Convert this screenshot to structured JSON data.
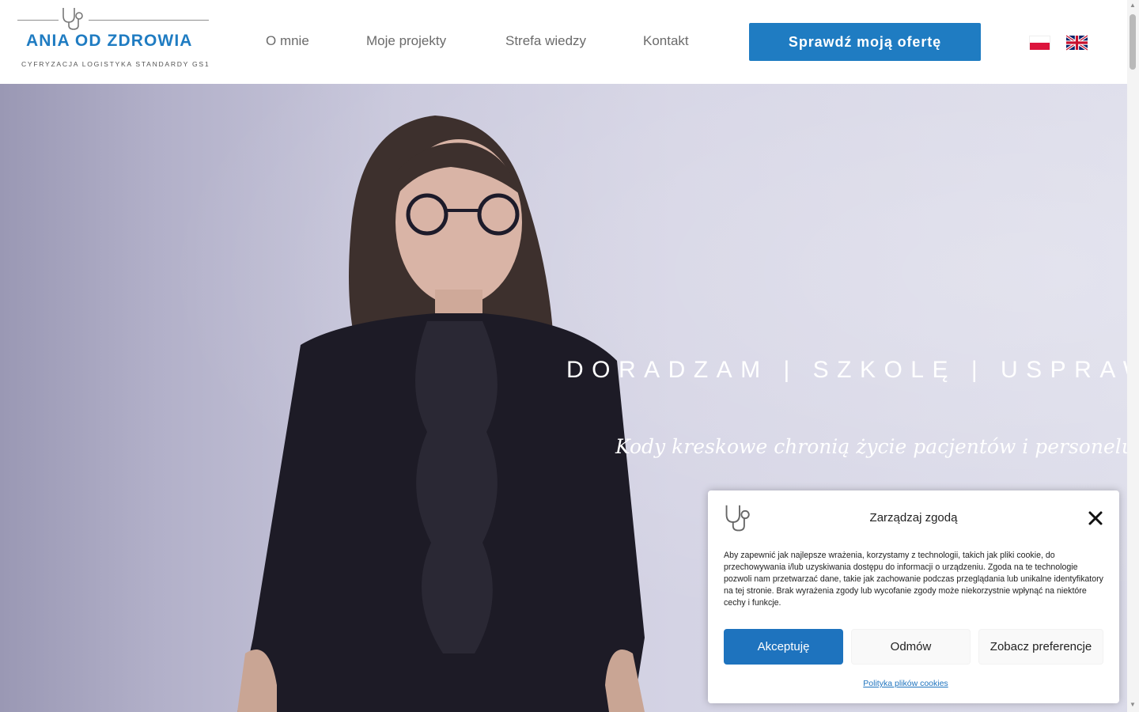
{
  "logo": {
    "title": "ANIA OD ZDROWIA",
    "subtitle": "CYFRYZACJA  LOGISTYKA  STANDARDY GS1",
    "icon": "stethoscope-icon"
  },
  "nav": {
    "items": [
      {
        "label": "O mnie"
      },
      {
        "label": "Moje projekty"
      },
      {
        "label": "Strefa wiedzy"
      },
      {
        "label": "Kontakt"
      }
    ],
    "cta_label": "Sprawdź moją ofertę",
    "languages": [
      {
        "icon": "flag-poland-icon"
      },
      {
        "icon": "flag-uk-icon"
      }
    ]
  },
  "hero": {
    "title": "DORADZAM | SZKOLĘ | USPRAWNIAM",
    "subtitle": "Kody kreskowe chronią życie pacjentów i personelu!"
  },
  "cookie": {
    "title": "Zarządzaj zgodą",
    "text": "Aby zapewnić jak najlepsze wrażenia, korzystamy z technologii, takich jak pliki cookie, do przechowywania i/lub uzyskiwania dostępu do informacji o urządzeniu. Zgoda na te technologie pozwoli nam przetwarzać dane, takie jak zachowanie podczas przeglądania lub unikalne identyfikatory na tej stronie. Brak wyrażenia zgody lub wycofanie zgody może niekorzystnie wpłynąć na niektóre cechy i funkcje.",
    "accept_label": "Akceptuję",
    "deny_label": "Odmów",
    "prefs_label": "Zobacz preferencje",
    "policy_link": "Polityka plików cookies"
  },
  "colors": {
    "brand_blue": "#1f7cc2",
    "button_blue": "#1e73be",
    "nav_text": "#6b6b6b"
  }
}
